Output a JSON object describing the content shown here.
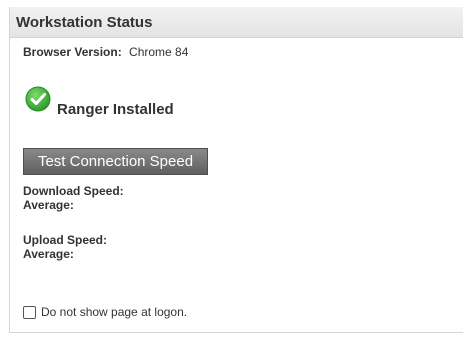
{
  "panel": {
    "title": "Workstation Status"
  },
  "browser": {
    "label": "Browser Version:",
    "value": "Chrome 84"
  },
  "ranger": {
    "status_icon": "check-circle-icon",
    "label": "Ranger Installed"
  },
  "test_button": {
    "label": "Test Connection Speed"
  },
  "download": {
    "speed_label": "Download Speed:",
    "average_label": "Average:"
  },
  "upload": {
    "speed_label": "Upload Speed:",
    "average_label": "Average:"
  },
  "logon": {
    "checkbox_checked": false,
    "label": "Do not show page at logon."
  },
  "colors": {
    "check_green": "#3aa935",
    "button_gray": "#6e6e6e"
  }
}
